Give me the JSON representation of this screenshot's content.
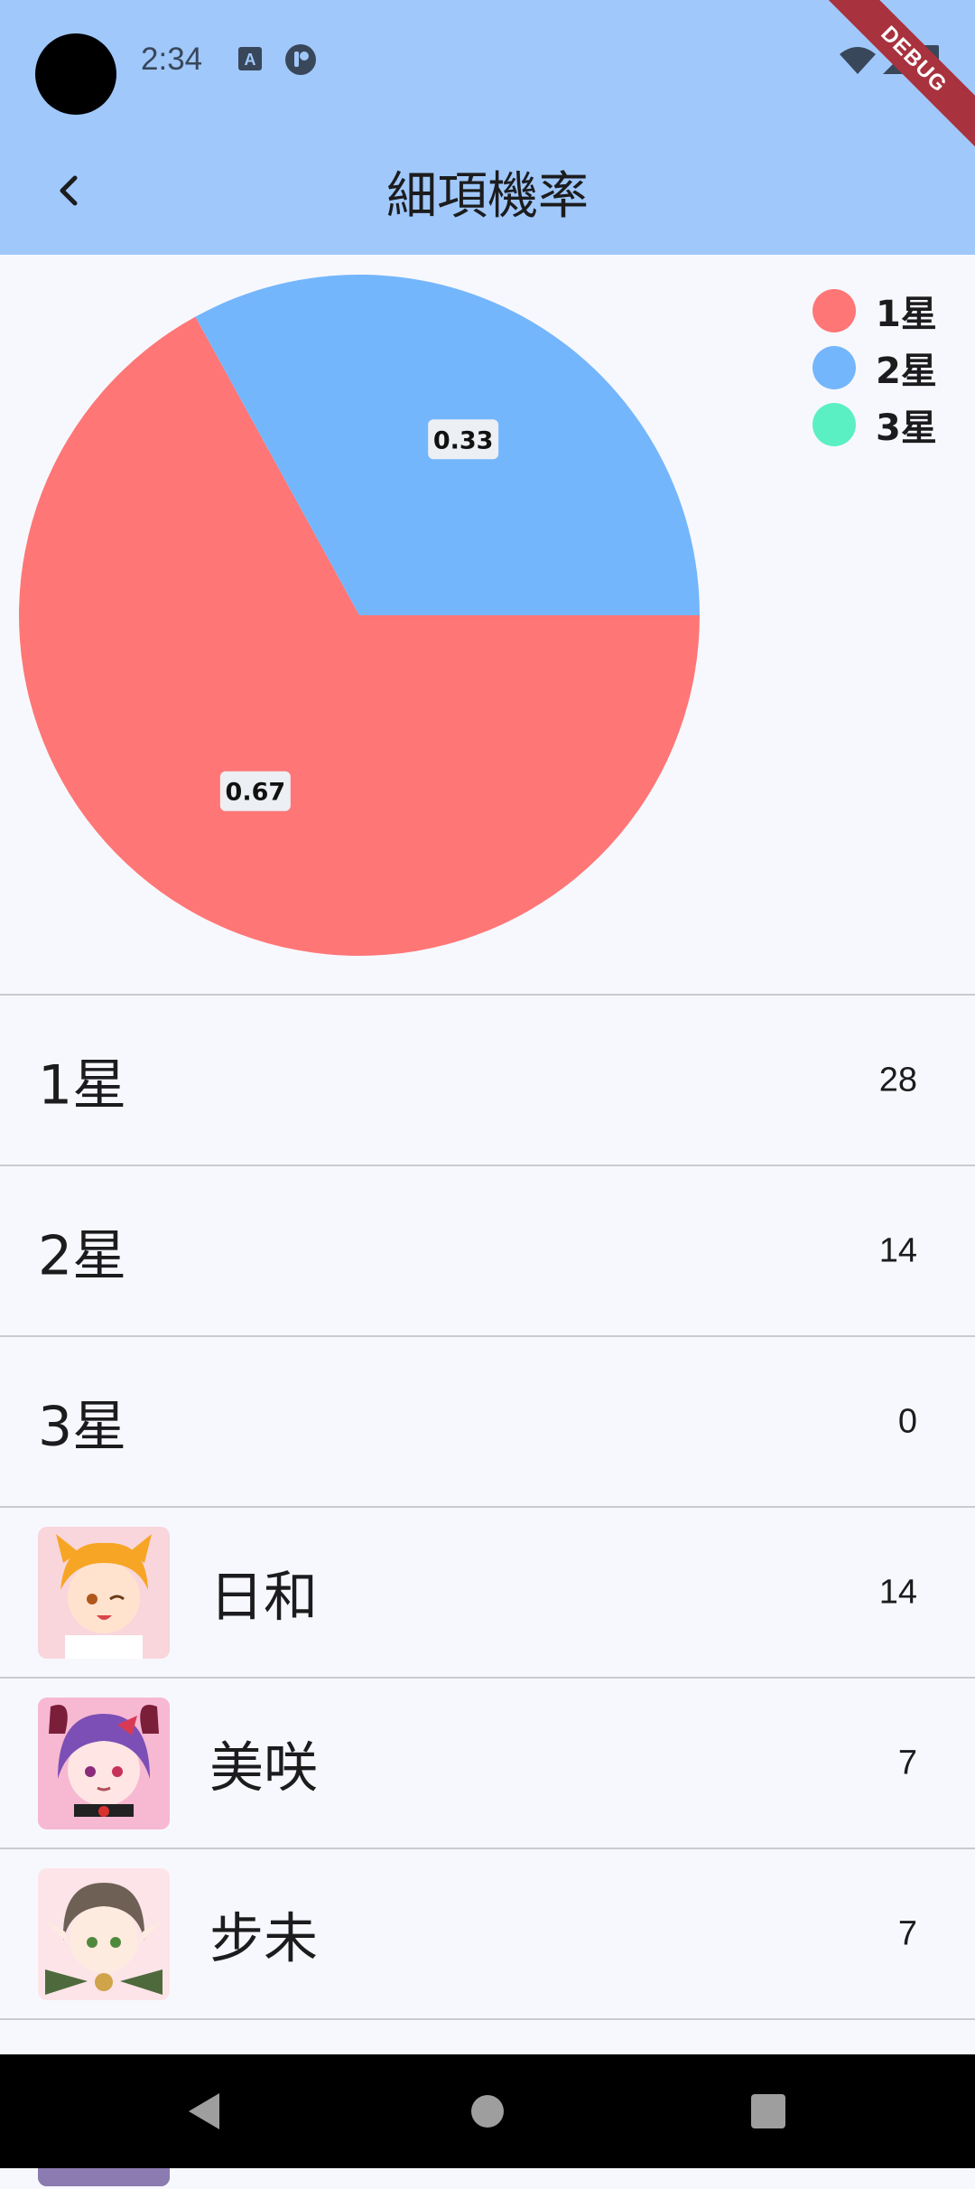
{
  "status_bar": {
    "time": "2:34",
    "debug_label": "DEBUG"
  },
  "app_bar": {
    "title": "細項機率"
  },
  "chart_data": {
    "type": "pie",
    "slices": [
      {
        "label": "1星",
        "value": 0.67,
        "color": "#ff7676"
      },
      {
        "label": "2星",
        "value": 0.33,
        "color": "#74b6fc"
      },
      {
        "label": "3星",
        "value": 0,
        "color": "#5af0c4"
      }
    ],
    "data_labels": [
      "0.67",
      "0.33"
    ],
    "legend_position": "right"
  },
  "legend": [
    {
      "label": "1星",
      "color": "#ff7676"
    },
    {
      "label": "2星",
      "color": "#74b6fc"
    },
    {
      "label": "3星",
      "color": "#5af0c4"
    }
  ],
  "rarity_rows": [
    {
      "label": "1星",
      "count": "28"
    },
    {
      "label": "2星",
      "count": "14"
    },
    {
      "label": "3星",
      "count": "0"
    }
  ],
  "character_rows": [
    {
      "name": "日和",
      "count": "14"
    },
    {
      "name": "美咲",
      "count": "7"
    },
    {
      "name": "步未",
      "count": "7"
    }
  ]
}
